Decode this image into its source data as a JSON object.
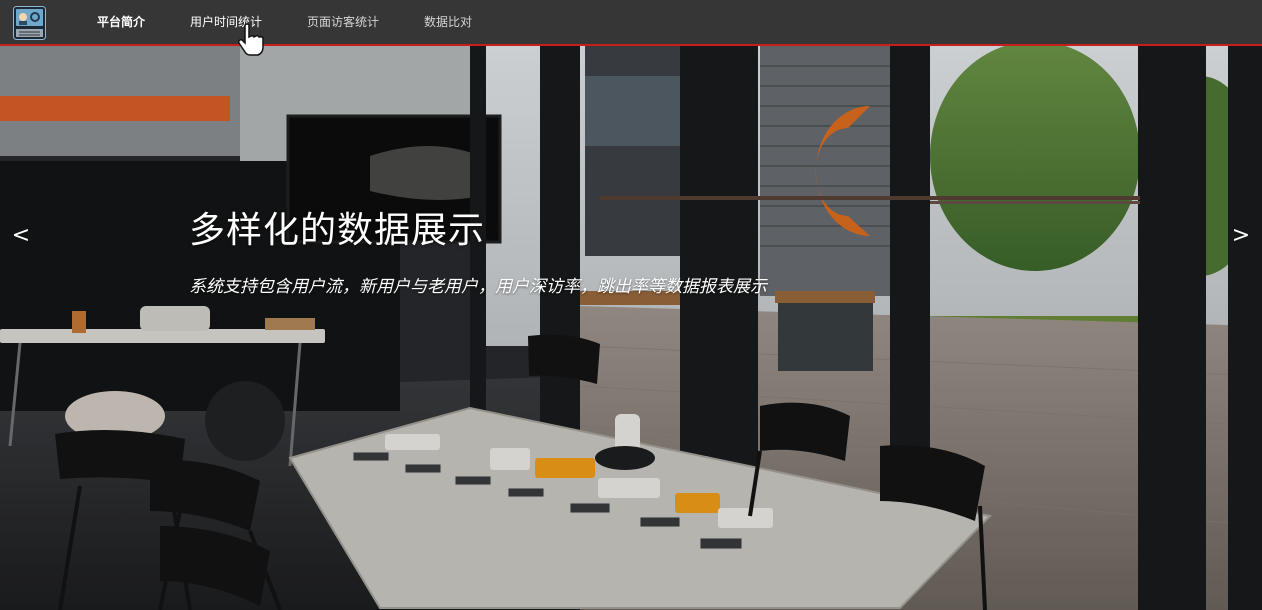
{
  "nav": {
    "logo_icon": "dashboard-logo-icon",
    "items": [
      {
        "label": "平台简介"
      },
      {
        "label": "用户时间统计"
      },
      {
        "label": "页面访客统计"
      },
      {
        "label": "数据比对"
      }
    ],
    "accent_color": "#c81e1e"
  },
  "carousel": {
    "title": "多样化的数据展示",
    "subtitle": "系统支持包含用户流，新用户与老用户，用户深访率，跳出率等数据报表展示",
    "prev_label": "<",
    "next_label": ">"
  }
}
